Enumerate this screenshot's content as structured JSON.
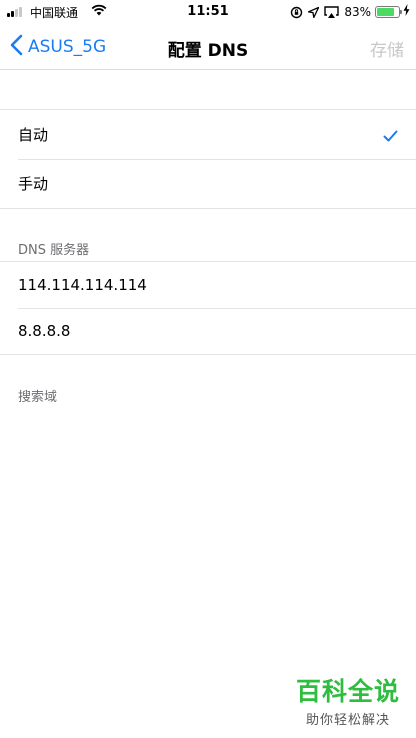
{
  "status_bar": {
    "carrier": "中国联通",
    "time": "11:51",
    "battery_percent": "83%",
    "battery_level": 0.83,
    "battery_color": "#4cd964"
  },
  "nav": {
    "back_label": "ASUS_5G",
    "title": "配置 DNS",
    "save_label": "存储"
  },
  "config_options": [
    {
      "label": "自动",
      "selected": true
    },
    {
      "label": "手动",
      "selected": false
    }
  ],
  "dns_section": {
    "header": "DNS 服务器",
    "servers": [
      "114.114.114.114",
      "8.8.8.8"
    ]
  },
  "search_domain": {
    "header": "搜索域"
  },
  "watermark": {
    "title": "百科全说",
    "subtitle": "助你轻松解决"
  },
  "colors": {
    "accent": "#1a7cf5",
    "disabled": "#c7c7cc",
    "watermark_green": "#2ebd3f"
  },
  "icons": [
    "cellular-signal-icon",
    "wifi-icon",
    "orientation-lock-icon",
    "location-arrow-icon",
    "airplay-icon",
    "battery-icon",
    "charging-bolt-icon",
    "back-chevron-icon",
    "checkmark-icon"
  ]
}
